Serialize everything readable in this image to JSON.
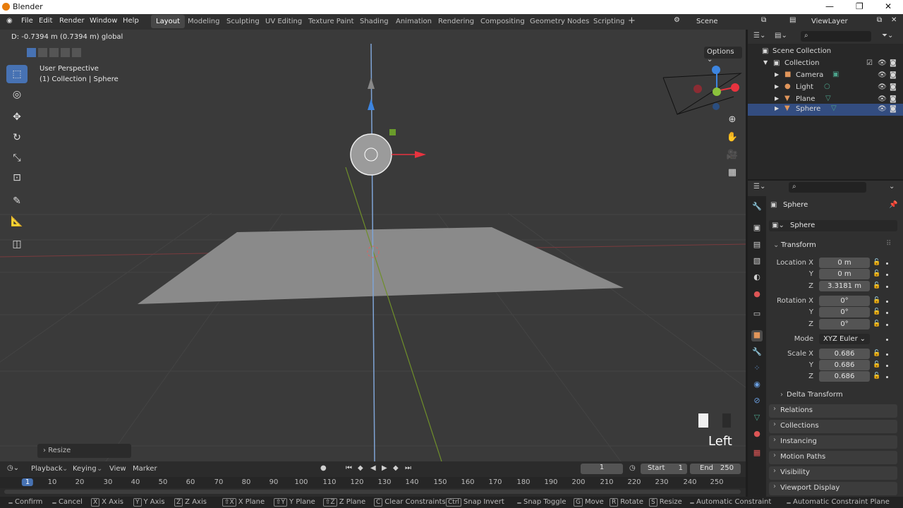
{
  "app": {
    "title": "Blender"
  },
  "menubar": {
    "items": [
      "File",
      "Edit",
      "Render",
      "Window",
      "Help"
    ],
    "workspaces": [
      "Layout",
      "Modeling",
      "Sculpting",
      "UV Editing",
      "Texture Paint",
      "Shading",
      "Animation",
      "Rendering",
      "Compositing",
      "Geometry Nodes",
      "Scripting"
    ],
    "active_workspace": "Layout",
    "add": "+",
    "scene": "Scene",
    "view_layer": "ViewLayer"
  },
  "viewport": {
    "header_info": "D: -0.7394 m (0.7394 m) global",
    "options": "Options",
    "perspective": "User Perspective",
    "collection_info": "(1) Collection | Sphere",
    "view_name": "Left",
    "last_op": "Resize"
  },
  "outliner": {
    "rows": [
      {
        "label": "Scene Collection",
        "selected": false
      },
      {
        "label": "Collection",
        "selected": false
      },
      {
        "label": "Camera",
        "selected": false
      },
      {
        "label": "Light",
        "selected": false
      },
      {
        "label": "Plane",
        "selected": false
      },
      {
        "label": "Sphere",
        "selected": true
      }
    ]
  },
  "properties": {
    "object_name": "Sphere",
    "data_name": "Sphere",
    "transform_title": "Transform",
    "location": {
      "label": "Location X",
      "x": "0 m",
      "y": "0 m",
      "z": "3.3181 m"
    },
    "rotation": {
      "label": "Rotation X",
      "x": "0°",
      "y": "0°",
      "z": "0°"
    },
    "mode": {
      "label": "Mode",
      "value": "XYZ Euler"
    },
    "scale": {
      "label": "Scale X",
      "x": "0.686",
      "y": "0.686",
      "z": "0.686"
    },
    "axis_y": "Y",
    "axis_z": "Z",
    "delta": "Delta Transform",
    "panels": [
      "Relations",
      "Collections",
      "Instancing",
      "Motion Paths",
      "Visibility",
      "Viewport Display"
    ]
  },
  "timeline": {
    "menus": [
      "Playback",
      "Keying",
      "View",
      "Marker"
    ],
    "current_frame": "1",
    "start_label": "Start",
    "start": "1",
    "end_label": "End",
    "end": "250",
    "ticks": [
      "1",
      "10",
      "20",
      "30",
      "40",
      "50",
      "60",
      "70",
      "80",
      "90",
      "100",
      "110",
      "120",
      "130",
      "140",
      "150",
      "160",
      "170",
      "180",
      "190",
      "200",
      "210",
      "220",
      "230",
      "240",
      "250"
    ]
  },
  "statusbar": [
    {
      "key": "",
      "label": "Confirm"
    },
    {
      "key": "",
      "label": "Cancel"
    },
    {
      "key": "X",
      "label": "X Axis"
    },
    {
      "key": "Y",
      "label": "Y Axis"
    },
    {
      "key": "Z",
      "label": "Z Axis"
    },
    {
      "key": "⇧X",
      "label": "X Plane"
    },
    {
      "key": "⇧Y",
      "label": "Y Plane"
    },
    {
      "key": "⇧Z",
      "label": "Z Plane"
    },
    {
      "key": "C",
      "label": "Clear Constraints"
    },
    {
      "key": "Ctrl",
      "label": "Snap Invert"
    },
    {
      "key": "",
      "label": "Snap Toggle"
    },
    {
      "key": "G",
      "label": "Move"
    },
    {
      "key": "R",
      "label": "Rotate"
    },
    {
      "key": "S",
      "label": "Resize"
    },
    {
      "key": "",
      "label": "Automatic Constraint"
    },
    {
      "key": "",
      "label": "Automatic Constraint Plane"
    }
  ],
  "colors": {
    "accent": "#4772b3",
    "x_axis": "#e8333f",
    "y_axis": "#8bc23c",
    "z_axis": "#3d85e0",
    "selected_row": "#334d80"
  }
}
